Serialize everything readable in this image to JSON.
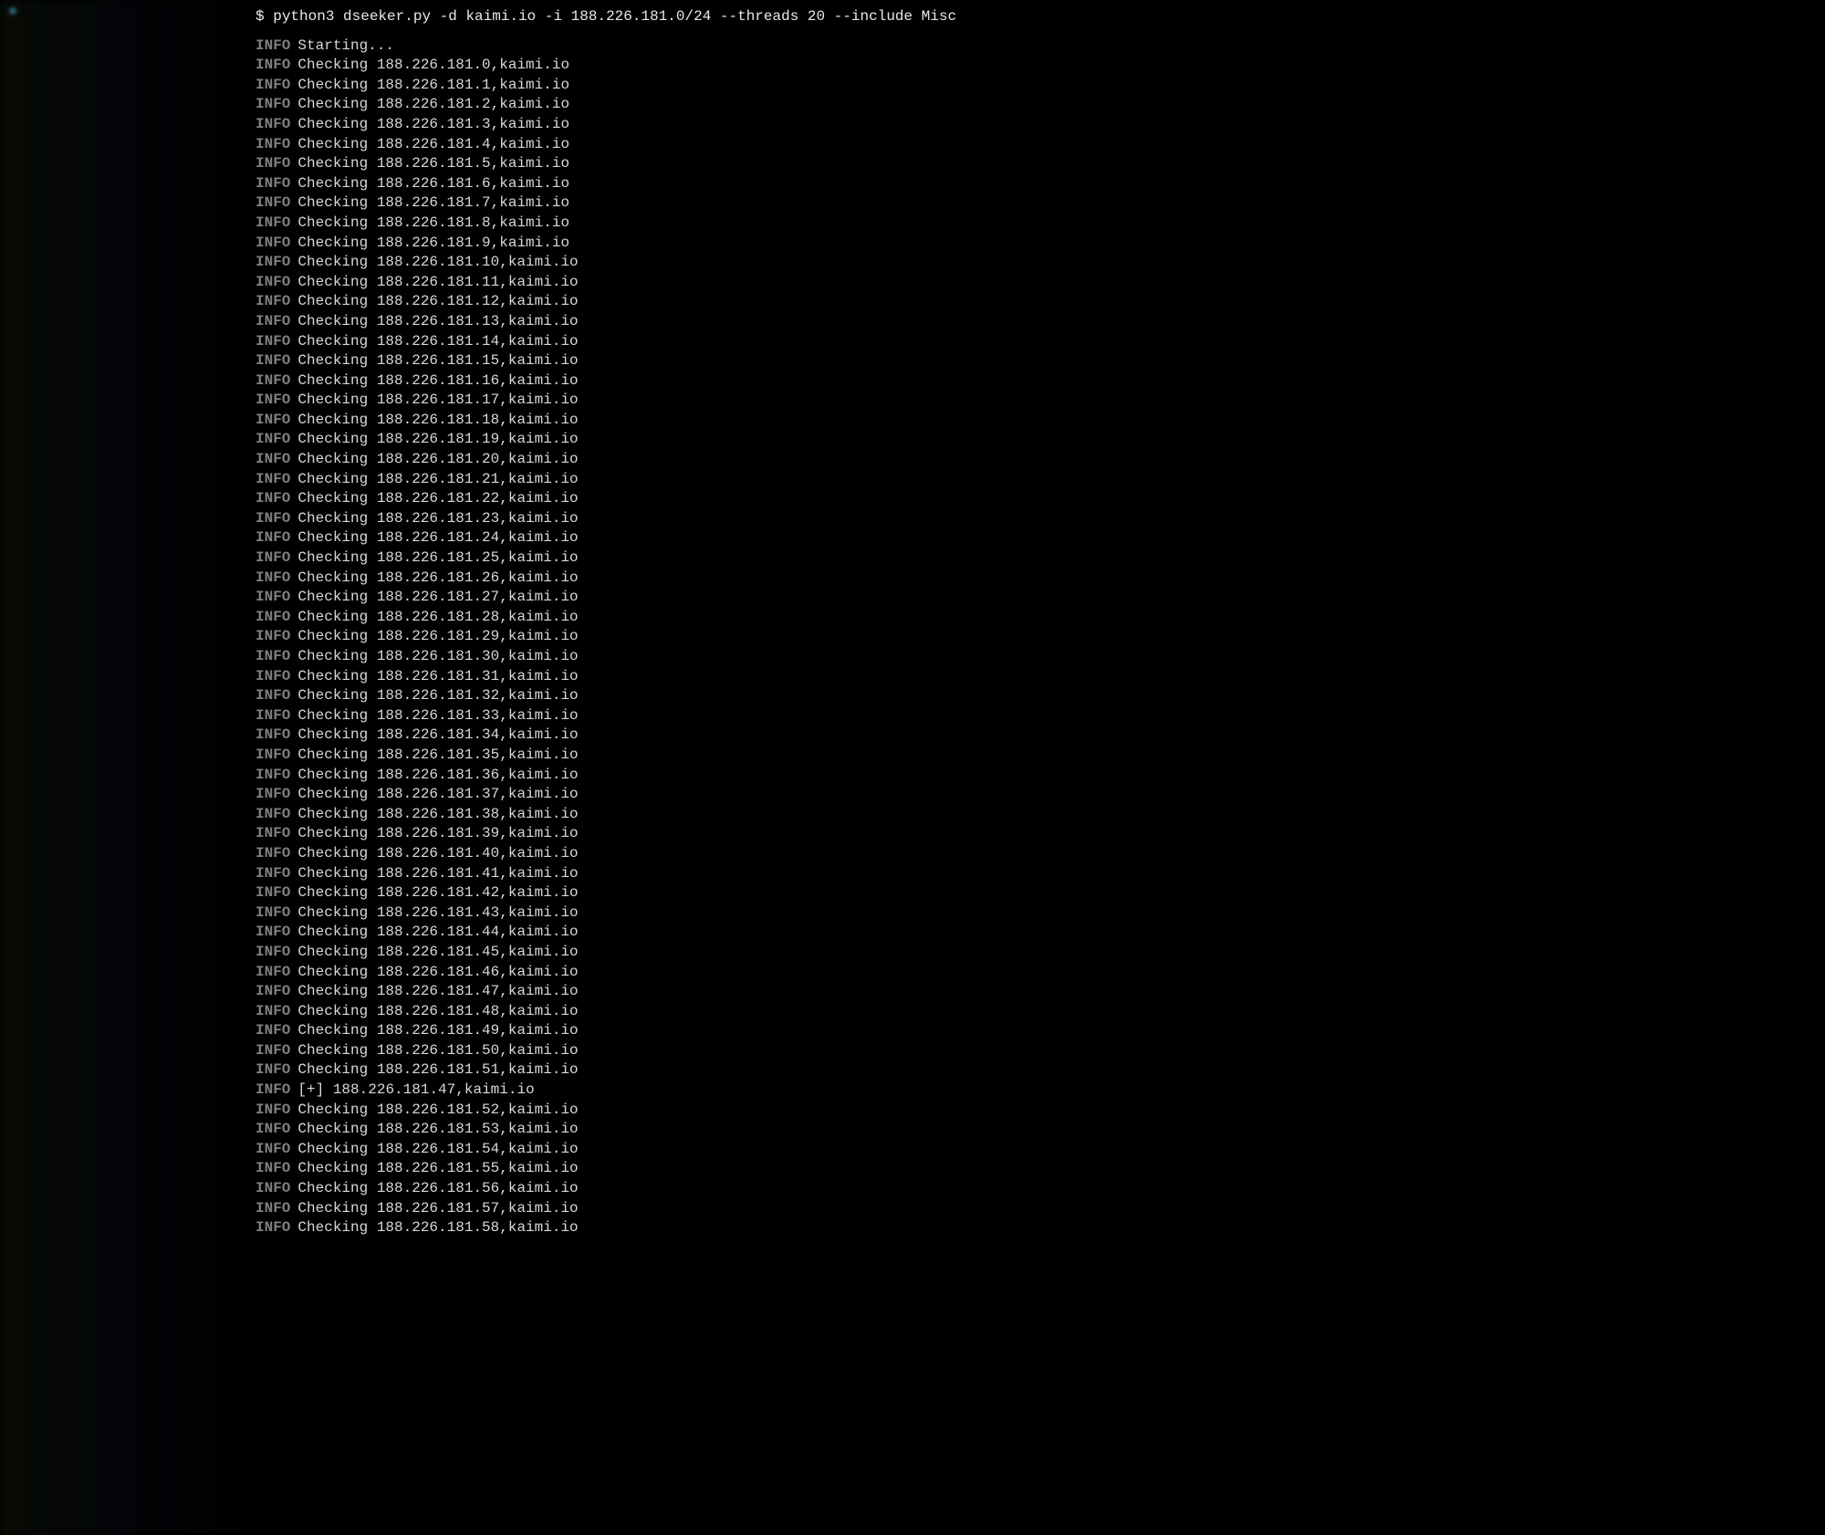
{
  "prompt": {
    "symbol": "$",
    "command": "python3 dseeker.py -d kaimi.io -i 188.226.181.0/24 --threads 20 --include Misc"
  },
  "start_line": {
    "level": "INFO",
    "text": "Starting..."
  },
  "info_label": "INFO",
  "checking_prefix": "Checking",
  "domain": "kaimi.io",
  "ip_base": "188.226.181",
  "check_lines_1": [
    0,
    1,
    2,
    3,
    4,
    5,
    6,
    7,
    8,
    9,
    10,
    11,
    12,
    13,
    14,
    15,
    16,
    17,
    18,
    19,
    20,
    21,
    22,
    23,
    24,
    25,
    26,
    27,
    28,
    29,
    30,
    31,
    32,
    33,
    34,
    35,
    36,
    37,
    38,
    39,
    40,
    41,
    42,
    43,
    44,
    45,
    46,
    47,
    48,
    49,
    50,
    51
  ],
  "result_line": {
    "level": "INFO",
    "prefix": "[+]",
    "ip": "188.226.181.47",
    "domain": "kaimi.io"
  },
  "check_lines_2": [
    52,
    53,
    54,
    55,
    56,
    57,
    58
  ]
}
